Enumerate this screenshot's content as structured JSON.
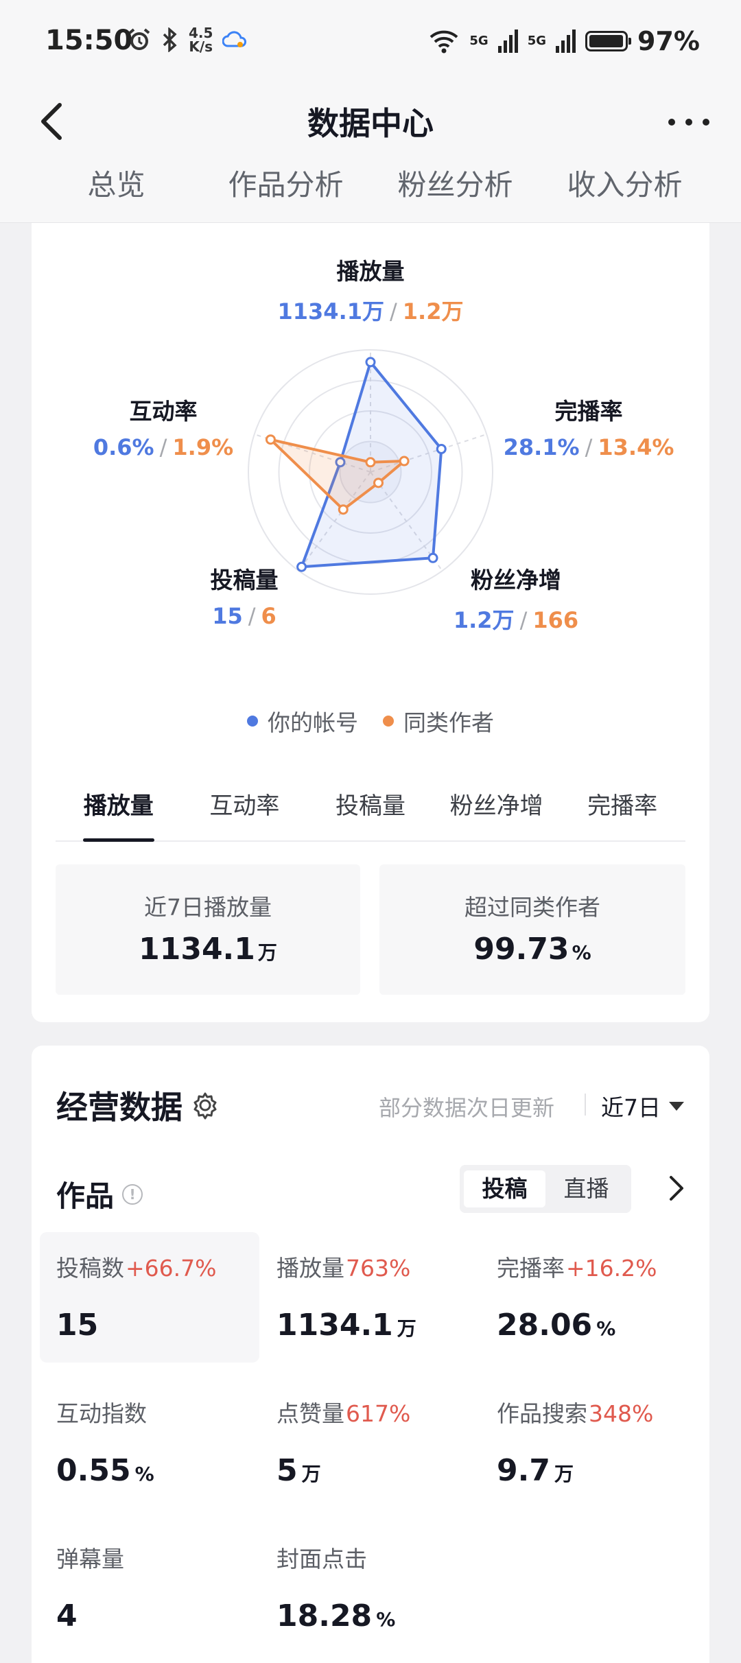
{
  "status_bar": {
    "time": "15:50",
    "speed_top": "4.5",
    "speed_bottom": "K/s",
    "net1": "5G",
    "net2": "5G",
    "battery_percent": 97,
    "battery_text": "97%"
  },
  "header": {
    "title": "数据中心"
  },
  "top_tabs": [
    {
      "label": "总览",
      "active": true
    },
    {
      "label": "作品分析",
      "active": false
    },
    {
      "label": "粉丝分析",
      "active": false
    },
    {
      "label": "收入分析",
      "active": false
    }
  ],
  "radar": {
    "axes": [
      {
        "label": "播放量",
        "mine": "1134.1万",
        "peer": "1.2万",
        "mine_norm": 0.9,
        "peer_norm": 0.08
      },
      {
        "label": "完播率",
        "mine": "28.1%",
        "peer": "13.4%",
        "mine_norm": 0.61,
        "peer_norm": 0.29
      },
      {
        "label": "粉丝净增",
        "mine": "1.2万",
        "peer": "166",
        "mine_norm": 0.87,
        "peer_norm": 0.11
      },
      {
        "label": "投稿量",
        "mine": "15",
        "peer": "6",
        "mine_norm": 0.96,
        "peer_norm": 0.38
      },
      {
        "label": "互动率",
        "mine": "0.6%",
        "peer": "1.9%",
        "mine_norm": 0.26,
        "peer_norm": 0.86
      }
    ],
    "legend": [
      {
        "label": "你的帐号",
        "color": "#4f79e0"
      },
      {
        "label": "同类作者",
        "color": "#ef8e4b"
      }
    ]
  },
  "metric_tabs": [
    {
      "label": "播放量",
      "active": true
    },
    {
      "label": "互动率",
      "active": false
    },
    {
      "label": "投稿量",
      "active": false
    },
    {
      "label": "粉丝净增",
      "active": false
    },
    {
      "label": "完播率",
      "active": false
    }
  ],
  "summary": {
    "left_label": "近7日播放量",
    "left_value": "1134.1",
    "left_unit": "万",
    "right_label": "超过同类作者",
    "right_value": "99.73",
    "right_unit": "%"
  },
  "ops": {
    "title": "经营数据",
    "note": "部分数据次日更新",
    "range": "近7日",
    "works_title": "作品",
    "seg_options": [
      {
        "label": "投稿",
        "active": true
      },
      {
        "label": "直播",
        "active": false
      }
    ],
    "metrics": [
      {
        "label": "投稿数",
        "change": "+66.7%",
        "value": "15",
        "unit": "",
        "highlight": true
      },
      {
        "label": "播放量",
        "change": "763%",
        "value": "1134.1",
        "unit": "万",
        "highlight": false
      },
      {
        "label": "完播率",
        "change": "+16.2%",
        "value": "28.06",
        "unit": "%",
        "highlight": false
      },
      {
        "label": "互动指数",
        "change": "",
        "value": "0.55",
        "unit": "%",
        "highlight": false
      },
      {
        "label": "点赞量",
        "change": "617%",
        "value": "5",
        "unit": "万",
        "highlight": false
      },
      {
        "label": "作品搜索",
        "change": "348%",
        "value": "9.7",
        "unit": "万",
        "highlight": false
      },
      {
        "label": "弹幕量",
        "change": "",
        "value": "4",
        "unit": "",
        "highlight": false
      },
      {
        "label": "封面点击",
        "change": "",
        "value": "18.28",
        "unit": "%",
        "highlight": false
      }
    ]
  },
  "colors": {
    "mine": "#4f79e0",
    "peer": "#ef8e4b",
    "change": "#e05a4e"
  }
}
